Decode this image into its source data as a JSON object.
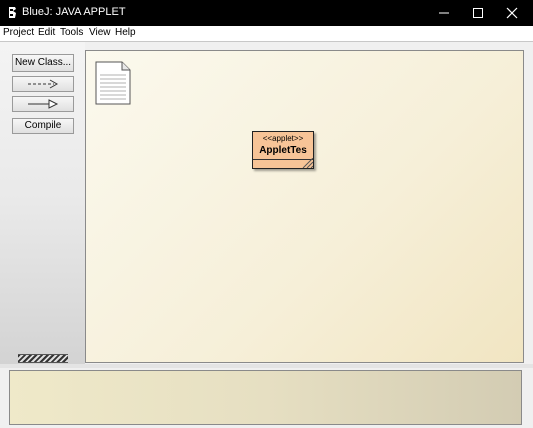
{
  "window": {
    "title": "BlueJ:  JAVA APPLET",
    "app_icon": "bluej-icon",
    "controls": [
      "minimize-icon",
      "maximize-icon",
      "close-icon"
    ]
  },
  "menu": {
    "items": [
      "Project",
      "Edit",
      "Tools",
      "View",
      "Help"
    ]
  },
  "toolbar": {
    "new_class_label": "New Class...",
    "uses_arrow_icon": "dashed-arrow-icon",
    "inheritance_arrow_icon": "solid-inheritance-arrow-icon",
    "compile_label": "Compile"
  },
  "diagram": {
    "readme_icon": "document-icon",
    "classes": [
      {
        "stereotype": "<<applet>>",
        "name": "AppletTes",
        "color": "#f7c497"
      }
    ]
  },
  "colors": {
    "titlebar": "#000000",
    "canvas": "#f6efd8",
    "class_fill": "#f7c497"
  }
}
